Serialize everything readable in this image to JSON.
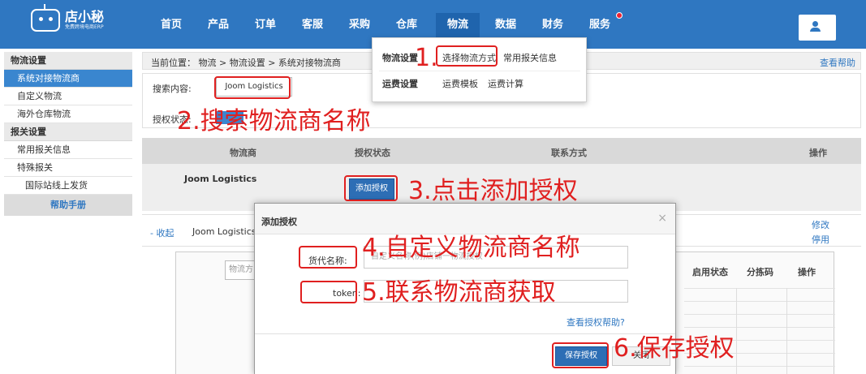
{
  "logo": {
    "name": "店小秘",
    "tagline": "免费跨境电商ERP"
  },
  "nav": {
    "items": [
      "首页",
      "产品",
      "订单",
      "客服",
      "采购",
      "仓库",
      "物流",
      "数据",
      "财务",
      "服务"
    ],
    "active": "物流"
  },
  "dropdown": {
    "group1": {
      "label": "物流设置",
      "items": [
        "选择物流方式",
        "常用报关信息"
      ]
    },
    "group2": {
      "label": "运费设置",
      "items": [
        "运费模板",
        "运费计算"
      ]
    }
  },
  "sidebar": {
    "section1": "物流设置",
    "items1": [
      "系统对接物流商",
      "自定义物流",
      "海外仓库物流"
    ],
    "section2": "报关设置",
    "items2": [
      "常用报关信息",
      "特殊报关"
    ],
    "sub_item": "国际站线上发货",
    "help": "帮助手册"
  },
  "main": {
    "breadcrumb": "当前位置： 物流 > 物流设置 > 系统对接物流商",
    "help_link": "查看帮助",
    "search_label": "搜索内容:",
    "search_value": "Joom Logistics",
    "auth_label": "授权状态:",
    "table_headers": [
      "物流商",
      "授权状态",
      "联系方式",
      "操作"
    ],
    "row_name": "Joom Logistics",
    "add_auth_button": "添加授权",
    "collapse": "- 收起",
    "sub_name": "Joom Logistics",
    "edit": "修改",
    "disable": "停用",
    "inner_filter_placeholder": "物流方",
    "inner_headers": [
      "启用状态",
      "分拣码",
      "操作"
    ]
  },
  "modal": {
    "title": "添加授权",
    "close_icon": "×",
    "forwarder_label": "货代名称:",
    "forwarder_placeholder": "自定义名称(例)店铺一物流授权",
    "token_label": "token:",
    "help_link": "查看授权帮助?",
    "save": "保存授权",
    "close": "关闭"
  },
  "annotations": [
    "1.",
    "2.搜索物流商名称",
    "3.点击添加授权",
    "4.自定义物流商名称",
    "5.联系物流商获取",
    "6.保存授权"
  ],
  "colors": {
    "nav": "#2f77c1",
    "accent": "#2d6eb5",
    "annotation": "#e02020"
  }
}
